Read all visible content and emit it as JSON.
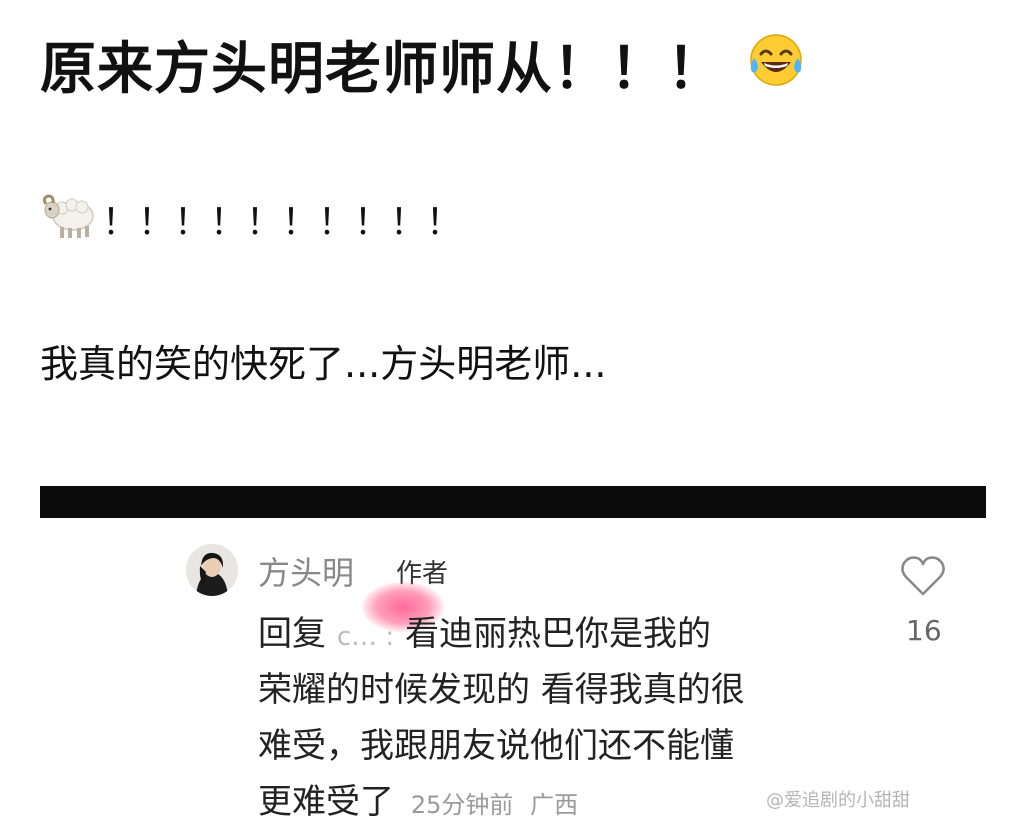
{
  "post": {
    "title": "原来方头明老师师从！！！",
    "title_emoji": "laughing-crying-emoji",
    "line2_emoji": "sheep-emoji",
    "line2_text": "！！！！！！！！！！",
    "line3_text": "我真的笑的快死了...方头明老师..."
  },
  "comment": {
    "author_name": "方头明",
    "author_tag": "作者",
    "reply_word": "回复",
    "reply_target": "c… :",
    "lines": [
      "看迪丽热巴你是我的",
      "荣耀的时候发现的 看得我真的很",
      "难受，我跟朋友说他们还不能懂",
      "更难受了"
    ],
    "time": "25分钟前",
    "location": "广西",
    "like_count": "16"
  },
  "watermark": "@爱追剧的小甜甜"
}
